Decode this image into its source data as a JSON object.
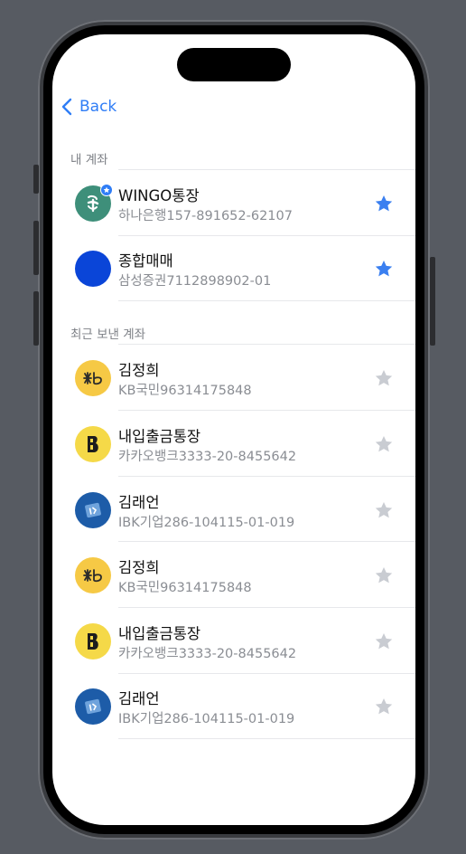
{
  "nav": {
    "back_label": "Back"
  },
  "sections": {
    "my_accounts": "내 계좌",
    "recent_accounts": "최근 보낸 계좌"
  },
  "accounts": [
    {
      "name": "WINGO통장",
      "detail": "하나은행157-891652-62107",
      "bank_icon": "hana-bank-logo-icon",
      "favorite": true
    },
    {
      "name": "종합매매",
      "detail": "삼성증권7112898902-01",
      "bank_icon": "samsung-securities-logo-icon",
      "favorite": true
    }
  ],
  "recent": [
    {
      "name": "김정희",
      "detail": "KB국민96314175848",
      "bank_icon": "kb-bank-logo-icon",
      "favorite": false
    },
    {
      "name": "내입출금통장",
      "detail": "카카오뱅크3333-20-8455642",
      "bank_icon": "kakao-bank-logo-icon",
      "favorite": false
    },
    {
      "name": "김래언",
      "detail": "IBK기업286-104115-01-019",
      "bank_icon": "ibk-bank-logo-icon",
      "favorite": false
    },
    {
      "name": "김정희",
      "detail": "KB국민96314175848",
      "bank_icon": "kb-bank-logo-icon",
      "favorite": false
    },
    {
      "name": "내입출금통장",
      "detail": "카카오뱅크3333-20-8455642",
      "bank_icon": "kakao-bank-logo-icon",
      "favorite": false
    },
    {
      "name": "김래언",
      "detail": "IBK기업286-104115-01-019",
      "bank_icon": "ibk-bank-logo-icon",
      "favorite": false
    }
  ],
  "colors": {
    "accent": "#2f7df6",
    "star_active": "#3a7ff0",
    "star_inactive": "#c9ccd2",
    "hana": "#3e8f7a",
    "samsung": "#0a45d8",
    "kb": "#f6c945",
    "kakao": "#f5d948",
    "ibk": "#1d5ca8"
  }
}
